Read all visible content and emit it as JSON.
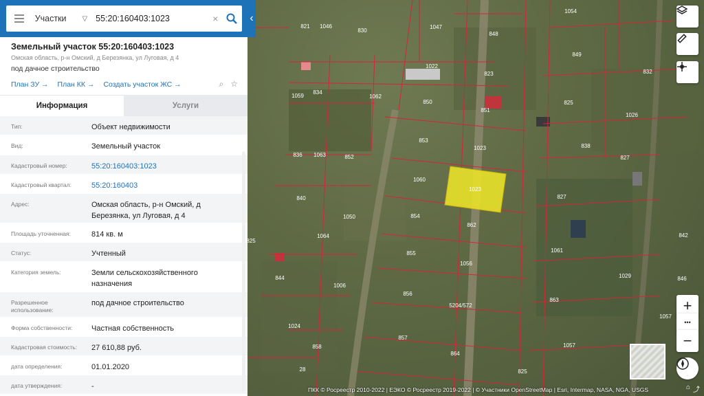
{
  "search": {
    "type_label": "Участки",
    "query": "55:20:160403:1023",
    "clear": "×"
  },
  "parcel": {
    "title": "Земельный участок 55:20:160403:1023",
    "address_small": "Омская область, р-н Омский, д Березянка, ул Луговая, д 4",
    "purpose": "под дачное строительство",
    "links": [
      "План ЗУ →",
      "План КК →",
      "Создать участок ЖС →"
    ]
  },
  "tabs": [
    "Информация",
    "Услуги"
  ],
  "info_rows": [
    {
      "label": "Тип:",
      "value": "Объект недвижимости",
      "link": false
    },
    {
      "label": "Вид:",
      "value": "Земельный участок",
      "link": false
    },
    {
      "label": "Кадастровый номер:",
      "value": "55:20:160403:1023",
      "link": true
    },
    {
      "label": "Кадастровый квартал:",
      "value": "55:20:160403",
      "link": true
    },
    {
      "label": "Адрес:",
      "value": "Омская область, р-н Омский, д Березянка, ул Луговая, д 4",
      "link": false
    },
    {
      "label": "Площадь уточненная:",
      "value": "814 кв. м",
      "link": false
    },
    {
      "label": "Статус:",
      "value": "Учтенный",
      "link": false
    },
    {
      "label": "Категория земель:",
      "value": "Земли сельскохозяйственного назначения",
      "link": false
    },
    {
      "label": "Разрешенное использование:",
      "value": "под дачное строительство",
      "link": false
    },
    {
      "label": "Форма собственности:",
      "value": "Частная собственность",
      "link": false
    },
    {
      "label": "Кадастровая стоимость:",
      "value": "27 610,88 руб.",
      "link": false
    },
    {
      "label": "дата определения:",
      "value": "01.01.2020",
      "link": false
    },
    {
      "label": "дата утверждения:",
      "value": "-",
      "link": false
    }
  ],
  "map": {
    "plot_labels": [
      "1054",
      "821",
      "1046",
      "830",
      "1047",
      "848",
      "849",
      "832",
      "1022",
      "823",
      "1059",
      "834",
      "1062",
      "850",
      "851",
      "825",
      "1026",
      "836",
      "1063",
      "852",
      "853",
      "1023",
      "838",
      "827",
      "1060",
      "840",
      "1050",
      "854",
      "862",
      "827",
      "842",
      "1064",
      "855",
      "1056",
      "1061",
      "844",
      "1006",
      "856",
      "5204/572",
      "863",
      "1029",
      "846",
      "1024",
      "857",
      "864",
      "1057",
      "1057",
      "858",
      "28",
      "825",
      "825"
    ],
    "highlight_label": "1023",
    "attribution": "ПКК © Росреестр 2010-2022 | ЕЭКО © Росреестр 2019-2022 | © Участники OpenStreetMap | Esri, Intermap, NASA, NGA, USGS",
    "colors": {
      "parcel_border": "#d2263a",
      "highlight_fill": "#e8e22a",
      "accent": "#1e72b8"
    }
  },
  "controls": {
    "zoom_in": "+",
    "more": "•••",
    "zoom_out": "−"
  }
}
